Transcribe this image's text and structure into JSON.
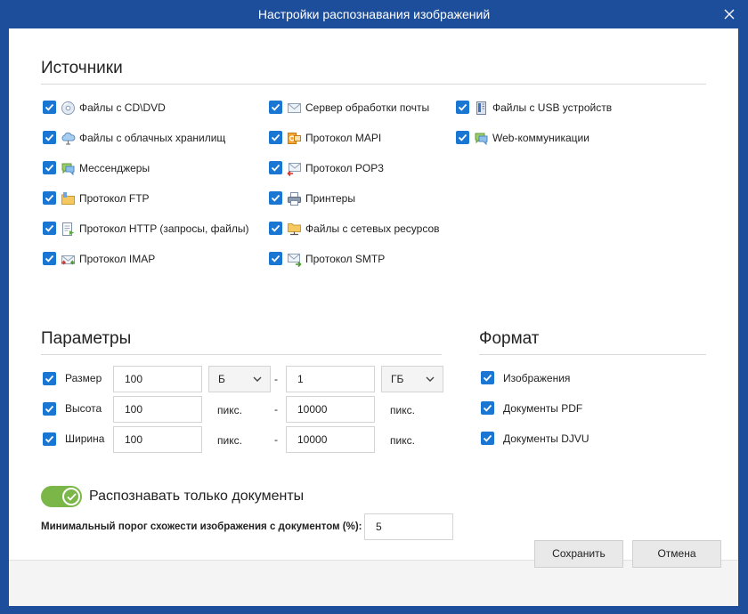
{
  "window": {
    "title": "Настройки распознавания изображений"
  },
  "sources": {
    "title": "Источники",
    "items": [
      {
        "label": "Файлы с CD\\DVD",
        "checked": true,
        "icon": "disc-icon"
      },
      {
        "label": "Файлы с облачных хранилищ",
        "checked": true,
        "icon": "cloud-icon"
      },
      {
        "label": "Мессенджеры",
        "checked": true,
        "icon": "chat-icon"
      },
      {
        "label": "Протокол FTP",
        "checked": true,
        "icon": "ftp-folder-icon"
      },
      {
        "label": "Протокол HTTP (запросы, файлы)",
        "checked": true,
        "icon": "http-document-icon"
      },
      {
        "label": "Протокол IMAP",
        "checked": true,
        "icon": "imap-icon"
      },
      {
        "label": "Сервер обработки почты",
        "checked": true,
        "icon": "mail-envelope-icon"
      },
      {
        "label": "Протокол MAPI",
        "checked": true,
        "icon": "mapi-icon"
      },
      {
        "label": "Протокол POP3",
        "checked": true,
        "icon": "pop3-icon"
      },
      {
        "label": "Принтеры",
        "checked": true,
        "icon": "printer-icon"
      },
      {
        "label": "Файлы с сетевых ресурсов",
        "checked": true,
        "icon": "network-folder-icon"
      },
      {
        "label": "Протокол SMTP",
        "checked": true,
        "icon": "smtp-icon"
      },
      {
        "label": "Файлы с USB устройств",
        "checked": true,
        "icon": "usb-drive-icon"
      },
      {
        "label": "Web-коммуникации",
        "checked": true,
        "icon": "web-chat-icon"
      }
    ]
  },
  "params": {
    "title": "Параметры",
    "size": {
      "label": "Размер",
      "checked": true,
      "min": "100",
      "min_unit": "Б",
      "max": "1",
      "max_unit": "ГБ"
    },
    "height": {
      "label": "Высота",
      "checked": true,
      "min": "100",
      "min_unit": "пикс.",
      "max": "10000",
      "max_unit": "пикс."
    },
    "width": {
      "label": "Ширина",
      "checked": true,
      "min": "100",
      "min_unit": "пикс.",
      "max": "10000",
      "max_unit": "пикс."
    },
    "dash": "-"
  },
  "format": {
    "title": "Формат",
    "items": [
      {
        "label": "Изображения",
        "checked": true
      },
      {
        "label": "Документы PDF",
        "checked": true
      },
      {
        "label": "Документы DJVU",
        "checked": true
      }
    ]
  },
  "docs_only": {
    "label": "Распознавать только документы",
    "enabled": true
  },
  "threshold": {
    "label": "Минимальный порог схожести изображения с документом (%):",
    "value": "5"
  },
  "buttons": {
    "save": "Сохранить",
    "cancel": "Отмена"
  },
  "colors": {
    "titlebar": "#1d4e9c",
    "checkbox": "#1976d2",
    "toggle": "#7ab648"
  }
}
